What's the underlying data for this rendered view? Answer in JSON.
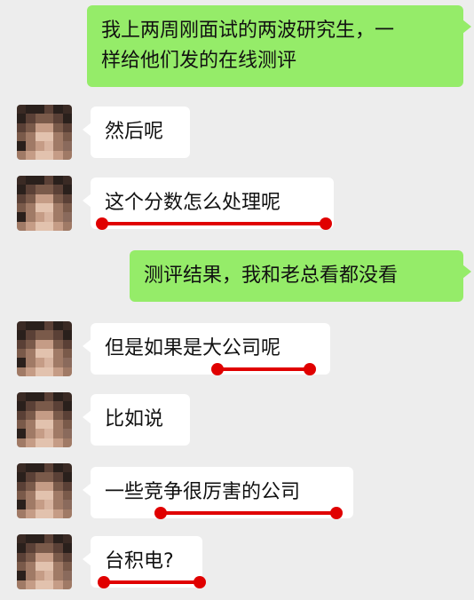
{
  "chat": {
    "messages": [
      {
        "side": "out",
        "text": "我上两周刚面试的两波研究生，一\n样给他们发的在线测评"
      },
      {
        "side": "in",
        "text": "然后呢"
      },
      {
        "side": "in",
        "text": "这个分数怎么处理呢"
      },
      {
        "side": "out",
        "text": "测评结果，我和老总看都没看"
      },
      {
        "side": "in",
        "text": "但是如果是大公司呢"
      },
      {
        "side": "in",
        "text": "比如说"
      },
      {
        "side": "in",
        "text": "一些竞争很厉害的公司"
      },
      {
        "side": "in",
        "text": "台积电?"
      }
    ]
  },
  "colors": {
    "background": "#ededed",
    "outgoing_bubble": "#95ec69",
    "incoming_bubble": "#ffffff",
    "annotation_red": "#e00000"
  },
  "icons": {
    "avatar": "pixelated-avatar-icon"
  }
}
